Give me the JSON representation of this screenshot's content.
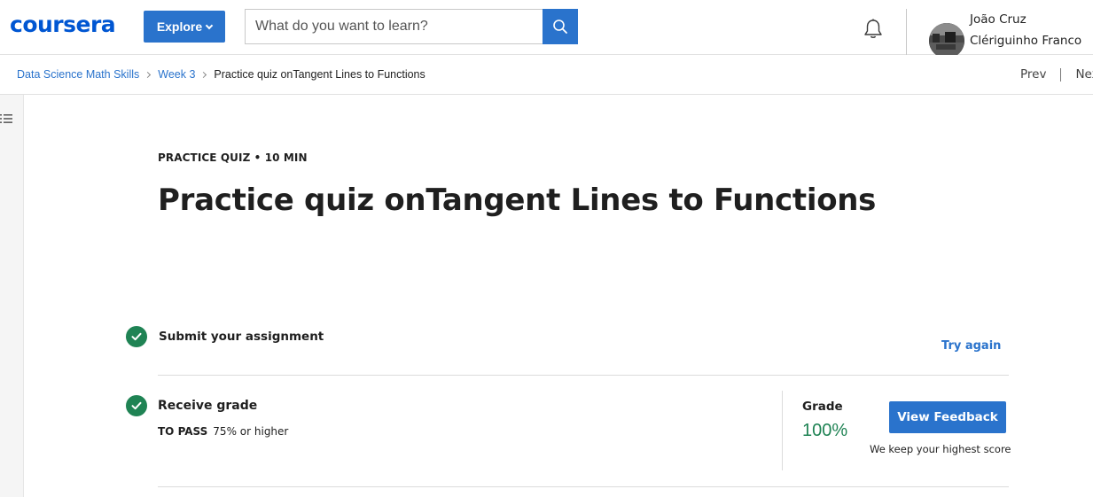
{
  "header": {
    "logo": "coursera",
    "explore_label": "Explore",
    "search": {
      "placeholder": "What do you want to learn?",
      "value": ""
    },
    "icons": [
      "chevron-down-icon",
      "search-icon",
      "bell-icon"
    ],
    "user": {
      "name": "João Cruz Clériguinho Franco Inverno"
    }
  },
  "breadcrumb": {
    "items": [
      "Data Science Math Skills",
      "Week 3",
      "Practice quiz onTangent Lines to Functions"
    ]
  },
  "nav": {
    "prev": "Prev",
    "next": "Nex"
  },
  "main": {
    "kicker": "PRACTICE QUIZ • 10 MIN",
    "title": "Practice quiz onTangent Lines to Functions",
    "step1": {
      "label": "Submit your assignment",
      "action": "Try again"
    },
    "step2": {
      "label": "Receive grade",
      "to_pass_label": "TO PASS",
      "to_pass_value": "75% or higher",
      "grade_label": "Grade",
      "grade_value": "100%",
      "view_feedback": "View Feedback",
      "note": "We keep your highest score"
    }
  },
  "colors": {
    "brand": "#0056d2",
    "accent": "#2a73cc",
    "success": "#1f8354"
  }
}
